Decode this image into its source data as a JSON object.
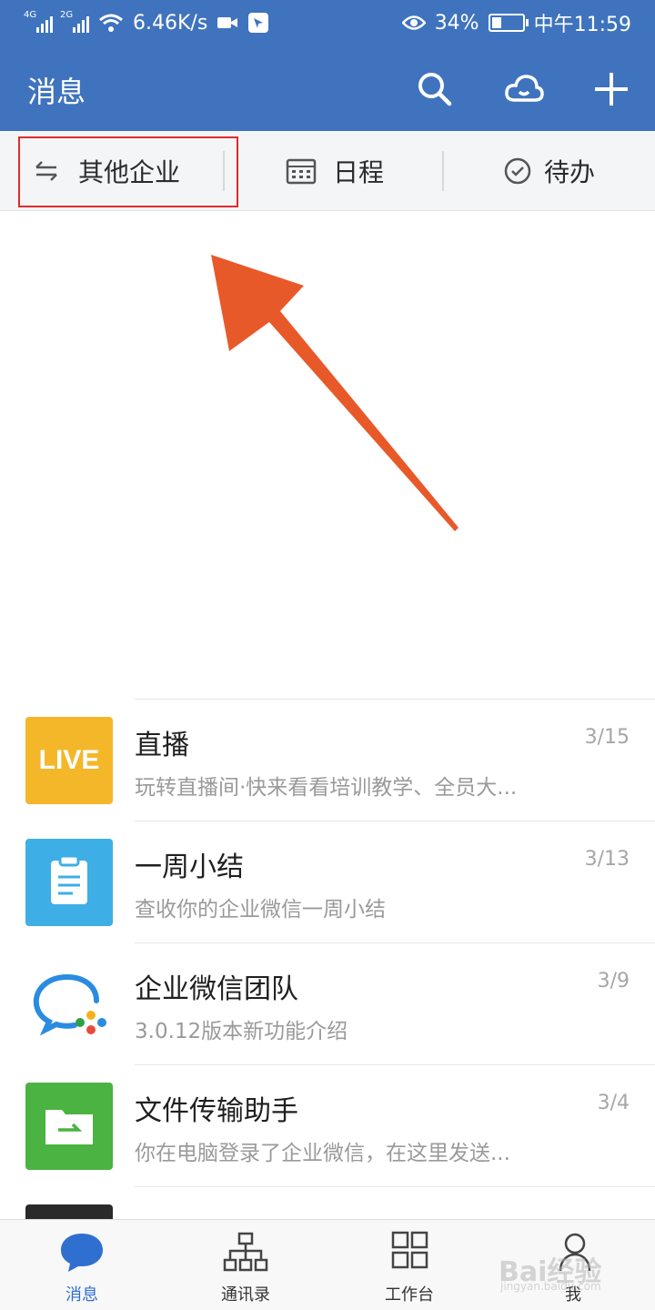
{
  "status_bar": {
    "net1": "4G",
    "net2": "2G",
    "speed": "6.46K/s",
    "battery": "34%",
    "battery_level": 0.34,
    "time": "中午11:59"
  },
  "appbar": {
    "title": "消息",
    "search_icon": "search-icon",
    "cloud_icon": "cloud-icon",
    "add_icon": "plus-icon"
  },
  "quickbar": {
    "other_company": "其他企业",
    "schedule": "日程",
    "todo": "待办"
  },
  "messages": [
    {
      "title": "直播",
      "subtitle": "玩转直播间·快来看看培训教学、全员大...",
      "date": "3/15",
      "avatar_text": "LIVE",
      "avatar_color": "#f5b72a"
    },
    {
      "title": "一周小结",
      "subtitle": "查收你的企业微信一周小结",
      "date": "3/13",
      "avatar_color": "#3eaee6"
    },
    {
      "title": "企业微信团队",
      "subtitle": "3.0.12版本新功能介绍",
      "date": "3/9",
      "avatar_color": "#ffffff"
    },
    {
      "title": "文件传输助手",
      "subtitle": "你在电脑登录了企业微信，在这里发送...",
      "date": "3/4",
      "avatar_color": "#4bb341"
    }
  ],
  "tabbar": {
    "tabs": [
      {
        "label": "消息",
        "icon": "chat-bubble-icon"
      },
      {
        "label": "通讯录",
        "icon": "org-chart-icon"
      },
      {
        "label": "工作台",
        "icon": "grid-icon"
      },
      {
        "label": "我",
        "icon": "person-icon"
      }
    ]
  },
  "watermark": {
    "text": "Bai经验",
    "sub": "jingyan.baidu.com"
  },
  "colors": {
    "primary": "#3f73be",
    "active_tab": "#2f6fd0",
    "highlight": "#e02a2a",
    "arrow": "#e8592a"
  }
}
